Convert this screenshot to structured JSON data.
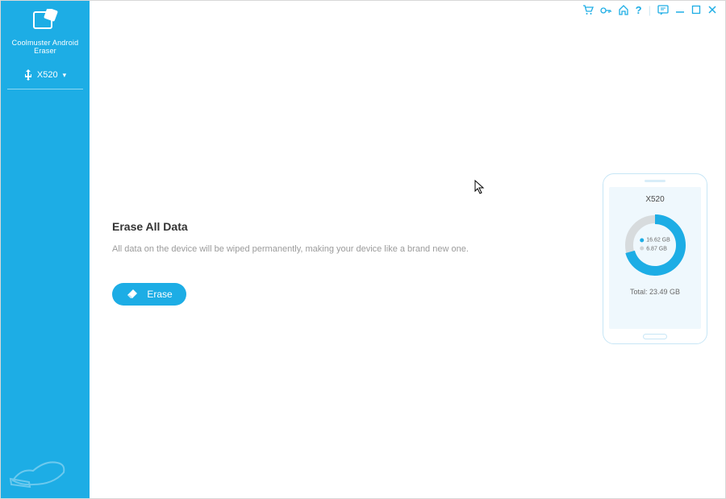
{
  "app": {
    "name": "Coolmuster Android Eraser"
  },
  "sidebar": {
    "device_name": "X520"
  },
  "titlebar": {
    "help_symbol": "?"
  },
  "main": {
    "heading": "Erase All Data",
    "description": "All data on the device will be wiped permanently, making your device like a brand new one.",
    "erase_label": "Erase"
  },
  "phone": {
    "name": "X520",
    "used_label": "16.62 GB",
    "free_label": "6.87 GB",
    "total_label": "Total: 23.49 GB",
    "used_gb": 16.62,
    "free_gb": 6.87,
    "total_gb": 23.49,
    "colors": {
      "used": "#1dade5",
      "free": "#d7dbdd"
    }
  }
}
